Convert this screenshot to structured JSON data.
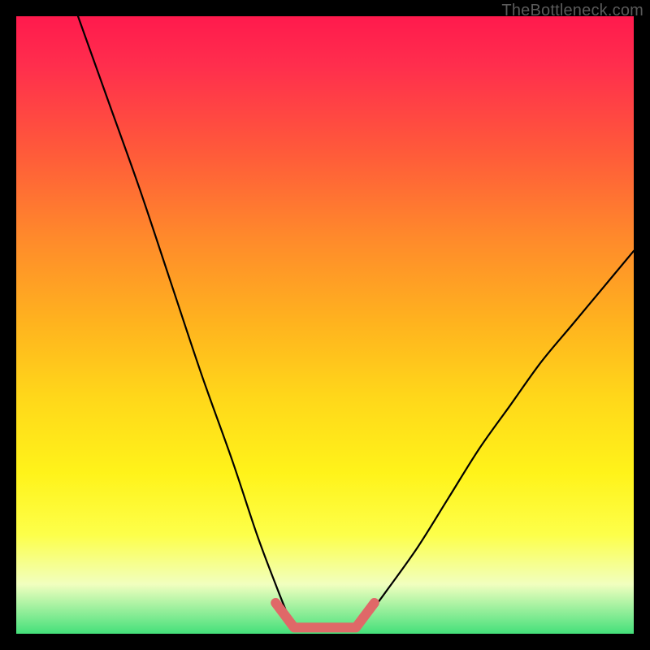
{
  "watermark": "TheBottleneck.com",
  "colors": {
    "page_bg": "#000000",
    "gradient_top": "#ff1a4d",
    "gradient_bottom": "#44e07a",
    "curve": "#000000",
    "marker": "#e06868"
  },
  "chart_data": {
    "type": "line",
    "title": "",
    "xlabel": "",
    "ylabel": "",
    "xlim": [
      0,
      100
    ],
    "ylim": [
      0,
      100
    ],
    "series": [
      {
        "name": "left-curve",
        "x": [
          10,
          15,
          20,
          25,
          30,
          35,
          39,
          42,
          44,
          45
        ],
        "y": [
          100,
          86,
          72,
          57,
          42,
          28,
          16,
          8,
          3,
          1
        ]
      },
      {
        "name": "right-curve",
        "x": [
          55,
          57,
          60,
          65,
          70,
          75,
          80,
          85,
          90,
          95,
          100
        ],
        "y": [
          1,
          3,
          7,
          14,
          22,
          30,
          37,
          44,
          50,
          56,
          62
        ]
      },
      {
        "name": "bottom-marker",
        "x": [
          42,
          45,
          55,
          58
        ],
        "y": [
          5,
          1,
          1,
          5
        ]
      }
    ]
  }
}
